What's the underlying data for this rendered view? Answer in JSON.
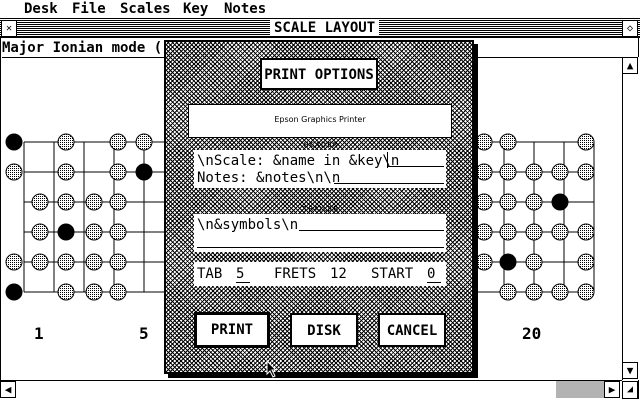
{
  "menu": {
    "items": [
      "Desk",
      "File",
      "Scales",
      "Key",
      "Notes"
    ]
  },
  "window": {
    "title": "SCALE LAYOUT",
    "info": "Major Ionian mode ("
  },
  "fretboard": {
    "fret_numbers": [
      "1",
      "5",
      "20"
    ]
  },
  "dialog": {
    "title_button": "PRINT OPTIONS",
    "printer_name": "Epson Graphics Printer",
    "header_label": "HEADER",
    "header_line1": "\\nScale: &name in &key\\n",
    "header_line2": "Notes: &notes\\n\\n",
    "trailer_label": "TRAILER",
    "trailer_line1": "\\n&symbols\\n",
    "trailer_line2": "",
    "tab_label": "TAB",
    "tab_value": "5",
    "frets_label": "FRETS",
    "frets_value": "12",
    "start_label": "START",
    "start_value": "0",
    "print_button": "PRINT",
    "disk_button": "DISK",
    "cancel_button": "CANCEL"
  }
}
